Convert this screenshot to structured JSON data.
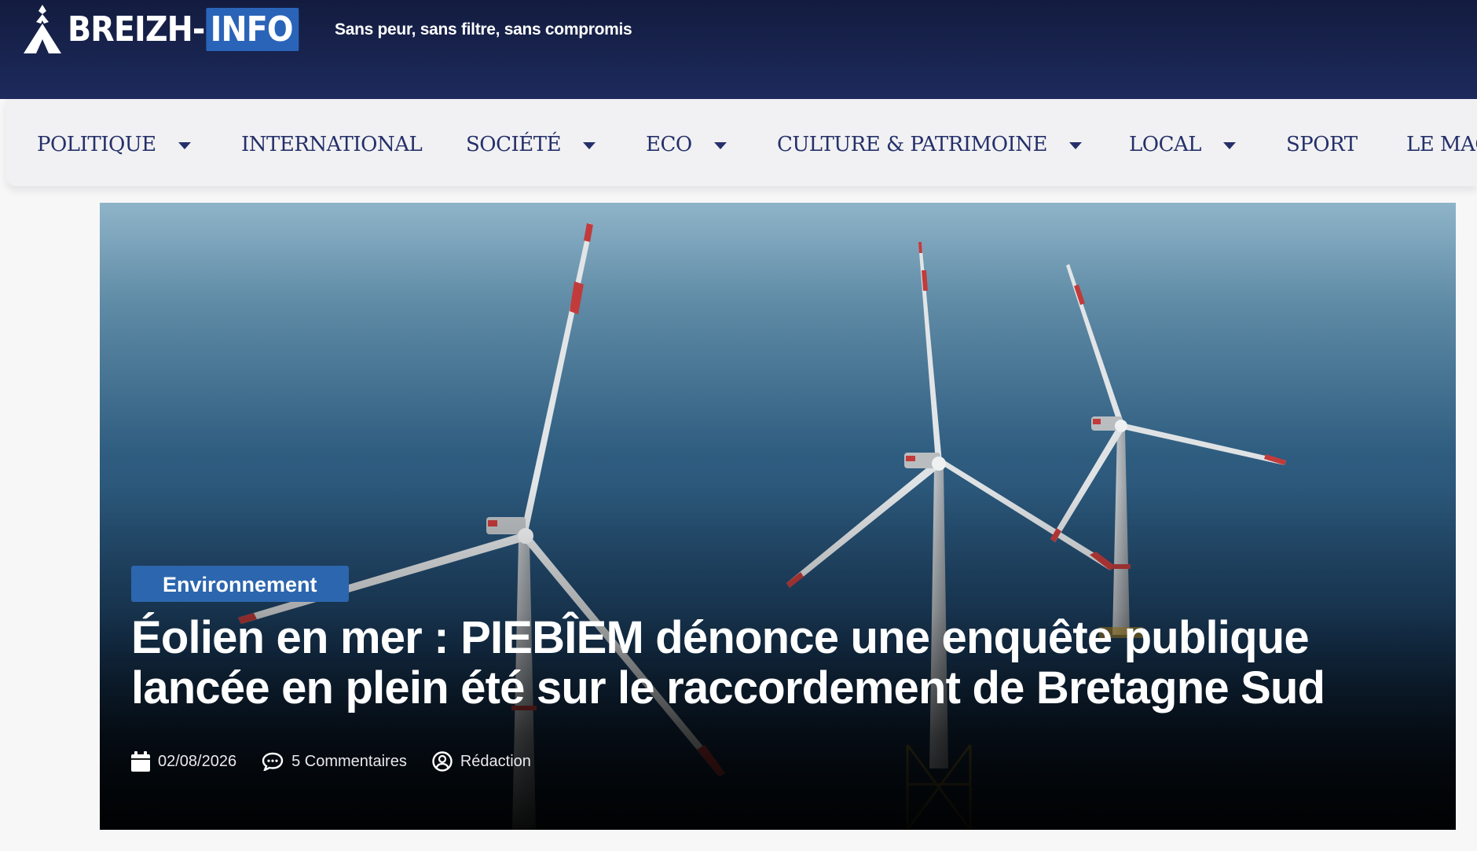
{
  "header": {
    "logo_text": "BREIZH-",
    "logo_accent": "INFO",
    "tagline": "Sans peur, sans filtre, sans compromis"
  },
  "nav": {
    "items": [
      {
        "label": "POLITIQUE",
        "dropdown": true
      },
      {
        "label": "INTERNATIONAL",
        "dropdown": false
      },
      {
        "label": "SOCIÉTÉ",
        "dropdown": true
      },
      {
        "label": "ECO",
        "dropdown": true
      },
      {
        "label": "CULTURE & PATRIMOINE",
        "dropdown": true
      },
      {
        "label": "LOCAL",
        "dropdown": true
      },
      {
        "label": "SPORT",
        "dropdown": false
      },
      {
        "label": "LE MAG",
        "dropdown": false
      }
    ]
  },
  "hero": {
    "category": "Environnement",
    "headline": "Éolien en mer : PIEBÎEM dénonce une enquête publique lancée en plein été sur le raccordement de Bretagne Sud",
    "date": "02/08/2026",
    "comments": "5 Commentaires",
    "author": "Rédaction",
    "image_subject": "offshore-wind-turbines"
  },
  "colors": {
    "header_bg": "#1d2a5c",
    "nav_bg": "#f1f1f3",
    "nav_text": "#25306a",
    "accent": "#2c66ae"
  },
  "icons": {
    "logo": "triskell-logo-icon",
    "caret": "caret-down-icon",
    "date": "calendar-icon",
    "comments": "comment-icon",
    "author": "user-circle-icon"
  }
}
